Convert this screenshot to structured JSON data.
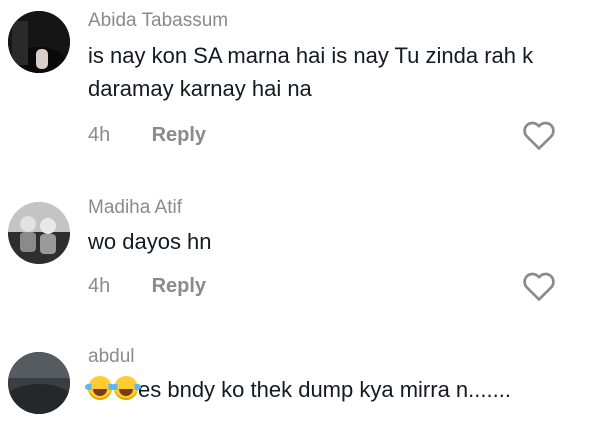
{
  "comments": [
    {
      "username": "Abida Tabassum",
      "text": "is nay kon SA marna hai is nay Tu zinda rah k daramay karnay hai na",
      "time": "4h",
      "reply_label": "Reply",
      "avatar_icon": "avatar-photo-dark-clothing",
      "like_icon": "heart-outline-icon"
    },
    {
      "username": "Madiha Atif",
      "text": "wo dayos hn",
      "time": "4h",
      "reply_label": "Reply",
      "avatar_icon": "avatar-photo-two-children",
      "like_icon": "heart-outline-icon"
    },
    {
      "username": "abdul",
      "emojis": [
        "face-with-tears-of-joy",
        "face-with-tears-of-joy"
      ],
      "text": "es bndy ko thek dump kya mirra n.......",
      "avatar_icon": "avatar-photo-dark-landscape"
    }
  ],
  "colors": {
    "username": "#8a8a8a",
    "text": "#161823",
    "meta": "#8a8a8a",
    "icon": "#8a8a8a",
    "background": "#ffffff"
  }
}
